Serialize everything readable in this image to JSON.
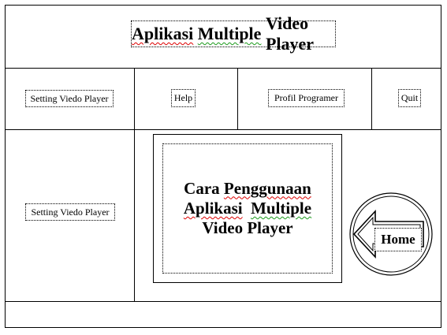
{
  "title": {
    "part1": "Aplikasi",
    "part2": "Multiple",
    "part3": "Video Player"
  },
  "menu": {
    "setting": "Setting Viedo Player",
    "help": "Help",
    "profil": "Profil Programer",
    "quit": "Quit"
  },
  "sidebar": {
    "setting": "Setting Viedo Player"
  },
  "content": {
    "line1a": "Cara",
    "line1b": "Penggunaan",
    "line2a": "Aplikasi",
    "line2b": "Multiple",
    "line3": "Video Player"
  },
  "home": {
    "label": "Home",
    "icon": "left-arrow-icon"
  },
  "colors": {
    "line": "#000000",
    "spell_red": "#dd0000",
    "spell_green": "#1a9a1a"
  }
}
